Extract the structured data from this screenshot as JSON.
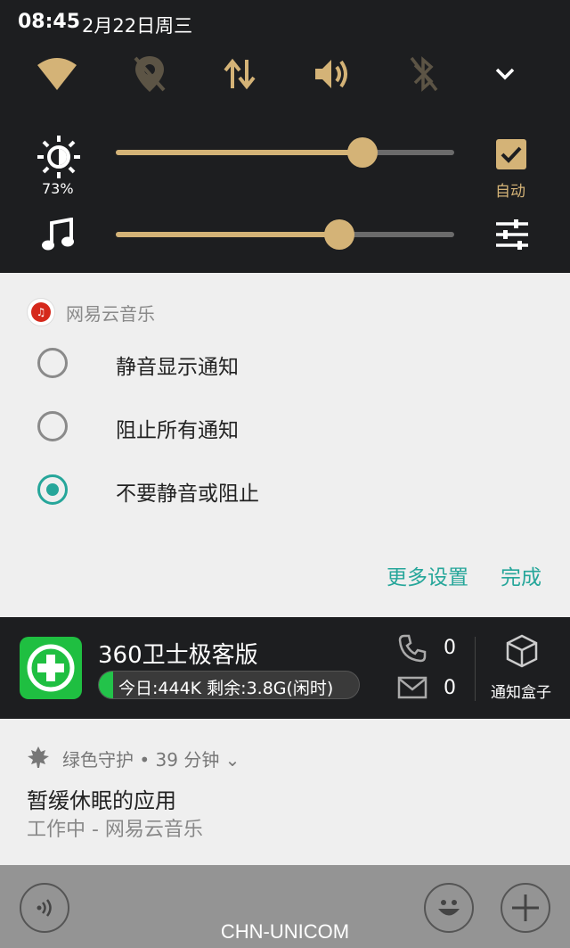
{
  "status": {
    "time": "08:45",
    "date": "2月22日周三"
  },
  "quick_settings": {
    "tiles": [
      "wifi-icon",
      "location-off-icon",
      "data-transfer-icon",
      "volume-icon",
      "bluetooth-off-icon",
      "expand-icon"
    ],
    "brightness": {
      "percent_label": "73%",
      "level": 0.73,
      "auto_label": "自动"
    },
    "media_volume": {
      "level": 0.66
    },
    "accent_color": "#d4b377"
  },
  "notification_settings": {
    "app_name": "网易云音乐",
    "options": [
      {
        "label": "静音显示通知",
        "selected": false
      },
      {
        "label": "阻止所有通知",
        "selected": false
      },
      {
        "label": "不要静音或阻止",
        "selected": true
      }
    ],
    "more_settings": "更多设置",
    "done": "完成",
    "accent_color": "#26a69a"
  },
  "card_360": {
    "title": "360卫士极客版",
    "traffic_text": "今日:444K 剩余:3.8G(闲时)",
    "calls": "0",
    "messages": "0",
    "box_label": "通知盒子"
  },
  "card_green": {
    "meta": "绿色守护 • 39 分钟 ⌄",
    "title": "暂缓休眠的应用",
    "subtitle": "工作中 - 网易云音乐"
  },
  "bottom": {
    "carrier": "CHN-UNICOM"
  }
}
